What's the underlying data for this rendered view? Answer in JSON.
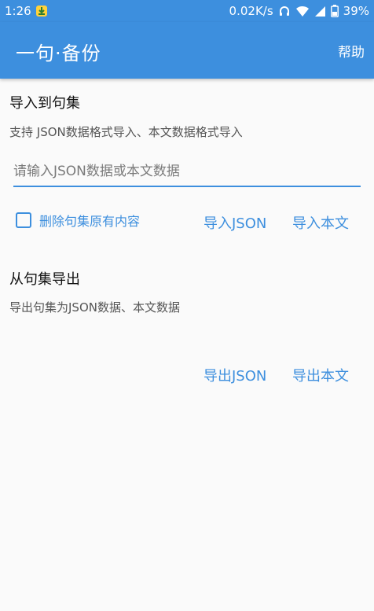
{
  "status_bar": {
    "time": "1:26",
    "network_speed": "0.02K/s",
    "battery": "39%",
    "icons": [
      "app-notification-icon",
      "headset-icon",
      "wifi-icon",
      "signal-icon",
      "battery-icon"
    ]
  },
  "app_bar": {
    "title": "一句·备份",
    "help": "帮助"
  },
  "import": {
    "title": "导入到句集",
    "description": "支持 JSON数据格式导入、本文数据格式导入",
    "input_placeholder": "请输入JSON数据或本文数据",
    "input_value": "",
    "checkbox_label": "删除句集原有内容",
    "checkbox_checked": false,
    "import_json": "导入JSON",
    "import_text": "导入本文"
  },
  "export": {
    "title": "从句集导出",
    "description": "导出句集为JSON数据、本文数据",
    "export_json": "导出JSON",
    "export_text": "导出本文"
  },
  "colors": {
    "primary": "#3d8fde",
    "background": "#fafafa",
    "text_primary": "#111111",
    "text_secondary": "#555555"
  }
}
